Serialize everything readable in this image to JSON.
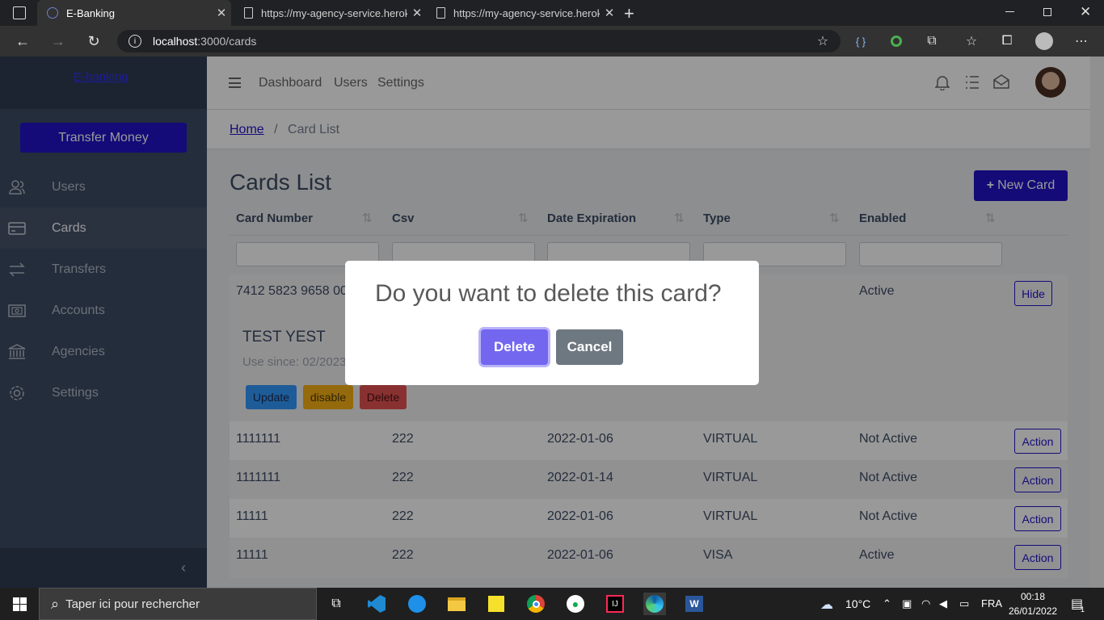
{
  "browser": {
    "tabs": [
      {
        "title": "E-Banking",
        "active": true
      },
      {
        "title": "https://my-agency-service.herok",
        "active": false
      },
      {
        "title": "https://my-agency-service.herok",
        "active": false
      }
    ],
    "url_host": "localhost",
    "url_path": ":3000/cards"
  },
  "sidebar": {
    "brand": "E-banking",
    "transfer_label": "Transfer Money",
    "items": [
      {
        "label": "Users",
        "icon": "users-icon"
      },
      {
        "label": "Cards",
        "icon": "credit-card-icon"
      },
      {
        "label": "Transfers",
        "icon": "transfer-icon"
      },
      {
        "label": "Accounts",
        "icon": "bank-account-icon"
      },
      {
        "label": "Agencies",
        "icon": "institution-icon"
      },
      {
        "label": "Settings",
        "icon": "gear-icon"
      }
    ]
  },
  "header": {
    "links": [
      "Dashboard",
      "Users",
      "Settings"
    ]
  },
  "breadcrumb": {
    "home": "Home",
    "separator": "/",
    "current": "Card List"
  },
  "page": {
    "title": "Cards List",
    "new_button": "New Card"
  },
  "table": {
    "columns": [
      "Card Number",
      "Csv",
      "Date Expiration",
      "Type",
      "Enabled"
    ],
    "expanded_row": {
      "card_number": "7412 5823 9658 00",
      "enabled": "Active",
      "toggle_label": "Hide",
      "holder": "TEST YEST",
      "since": "Use since: 02/2023",
      "update_label": "Update",
      "disable_label": "disable",
      "delete_label": "Delete"
    },
    "rows": [
      {
        "card_number": "1111111",
        "csv": "222",
        "date": "2022-01-06",
        "type": "VIRTUAL",
        "enabled": "Not Active",
        "action": "Action"
      },
      {
        "card_number": "1111111",
        "csv": "222",
        "date": "2022-01-14",
        "type": "VIRTUAL",
        "enabled": "Not Active",
        "action": "Action"
      },
      {
        "card_number": "11111",
        "csv": "222",
        "date": "2022-01-06",
        "type": "VIRTUAL",
        "enabled": "Not Active",
        "action": "Action"
      },
      {
        "card_number": "11111",
        "csv": "222",
        "date": "2022-01-06",
        "type": "VISA",
        "enabled": "Active",
        "action": "Action"
      }
    ]
  },
  "modal": {
    "title": "Do you want to delete this card?",
    "confirm": "Delete",
    "cancel": "Cancel"
  },
  "taskbar": {
    "search_placeholder": "Taper ici pour rechercher",
    "weather": "10°C",
    "lang": "FRA",
    "time": "00:18",
    "date": "26/01/2022",
    "notif_count": "1"
  },
  "colors": {
    "primary": "#2213c9",
    "sidebar": "#3c4b64",
    "modal_confirm": "#7367f0",
    "modal_cancel": "#6e7881"
  }
}
